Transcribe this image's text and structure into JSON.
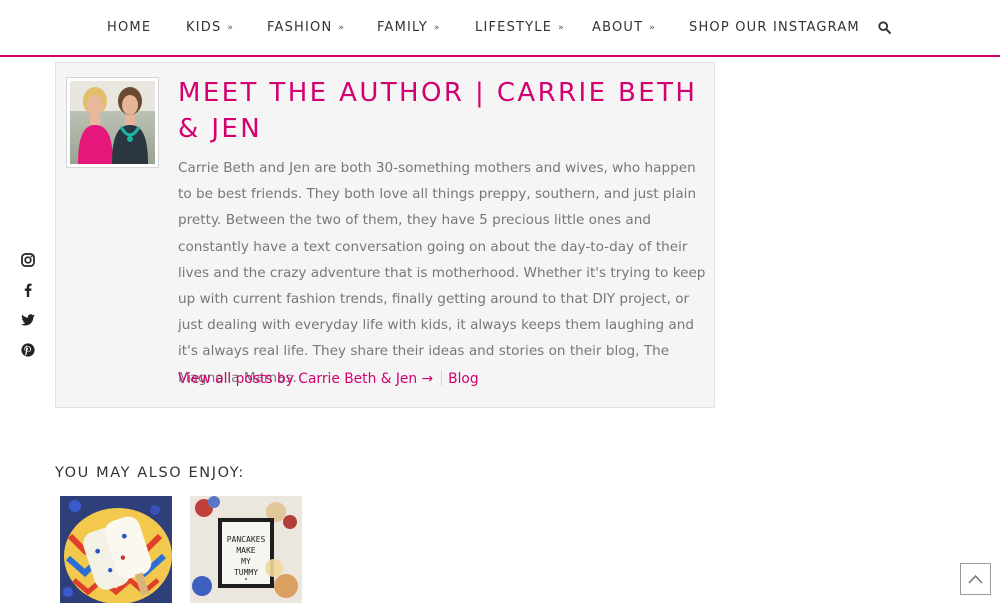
{
  "nav": {
    "items": [
      {
        "label": "HOME",
        "has_dropdown": false
      },
      {
        "label": "KIDS",
        "has_dropdown": true
      },
      {
        "label": "FASHION",
        "has_dropdown": true
      },
      {
        "label": "FAMILY",
        "has_dropdown": true
      },
      {
        "label": "LIFESTYLE",
        "has_dropdown": true
      },
      {
        "label": "ABOUT",
        "has_dropdown": true
      },
      {
        "label": "SHOP OUR INSTAGRAM",
        "has_dropdown": false
      }
    ],
    "dropdown_glyph": "»",
    "search_icon": "search-icon"
  },
  "social": {
    "icons": [
      "instagram-icon",
      "facebook-icon",
      "twitter-icon",
      "pinterest-icon"
    ]
  },
  "author": {
    "title": "MEET THE AUTHOR | CARRIE BETH & JEN",
    "bio": "Carrie Beth and Jen are both 30-something mothers and wives, who happen to be best friends. They both love all things preppy, southern, and just plain pretty. Between the two of them, they have 5 precious little ones and constantly have a text conversation going on about the day-to-day of their lives and the crazy adventure that is motherhood. Whether it's trying to keep up with current fashion trends, finally getting around to that DIY project, or just dealing with everyday life with kids, it always keeps them laughing and it's always real life. They share their ideas and stories on their blog, The Magnolia Mamas.",
    "view_all_label": "View all posts by Carrie Beth & Jen →",
    "blog_label": "Blog"
  },
  "related": {
    "heading": "YOU MAY ALSO ENJOY:",
    "letterboard_lines": [
      "PANCAKES",
      "MAKE",
      "MY",
      "TUMMY",
      "\""
    ]
  },
  "colors": {
    "accent": "#d4006f",
    "body_text": "#777777",
    "box_bg": "#f5f5f5"
  },
  "back_to_top_icon": "chevron-up-icon"
}
